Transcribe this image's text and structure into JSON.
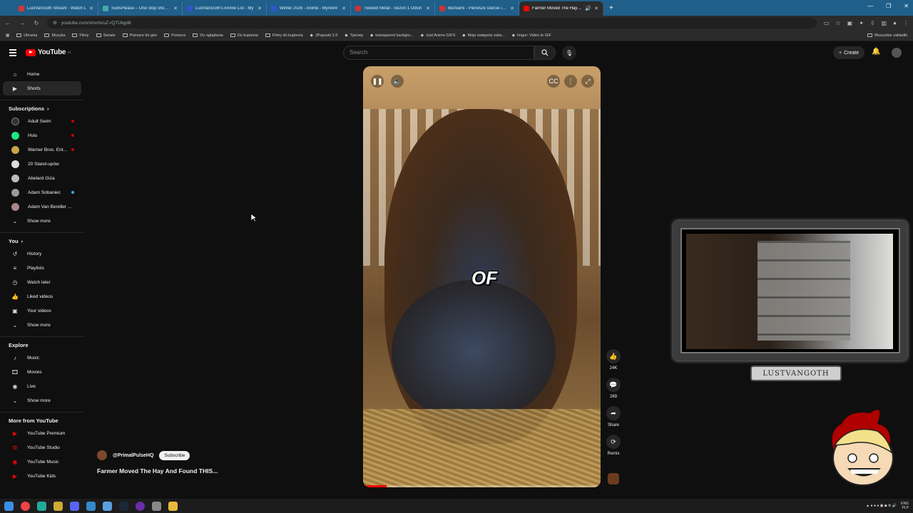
{
  "browser": {
    "tabs": [
      {
        "label": "LustVanGoth Stream · Watch L",
        "color": "#d33"
      },
      {
        "label": "SubsPlease – One stop shop fo",
        "color": "#4aa"
      },
      {
        "label": "LustVanGoth's Anime List - My",
        "color": "#35c"
      },
      {
        "label": "Winter 2026 - Anime - MyAnim",
        "color": "#35c"
      },
      {
        "label": "Twisted Metal - Sezon 1 Odcin",
        "color": "#c33"
      },
      {
        "label": "Bezkarni - Pierwsze starcie / Th",
        "color": "#c33"
      },
      {
        "label": "Farmer Moved The Hay An",
        "color": "#f00",
        "active": true
      }
    ],
    "url": "youtube.com/shorts/uZ-rQ7Ukgd8",
    "bookmarks": [
      "Ubrania",
      "Muzyka",
      "Filmy",
      "Seriale",
      "Pomoce do gier",
      "Pomoce",
      "Do oglądania",
      "Do kupienia",
      "Filmy do kupienia",
      "JPopsuki 2.0",
      "Tpexep",
      "transparent backgro...",
      "Just Anime GIFS",
      "Moje wstępnie zatw...",
      "Imgur: Video to GIF"
    ],
    "bookmarks_right": "Wszystkie zakładki"
  },
  "youtube": {
    "logo": "YouTube",
    "region": "PL",
    "search_placeholder": "Search",
    "create_label": "Create",
    "sidebar": {
      "top": [
        {
          "label": "Home",
          "icon": "home"
        },
        {
          "label": "Shorts",
          "icon": "shorts",
          "active": true
        }
      ],
      "subscriptions_title": "Subscriptions",
      "subscriptions": [
        {
          "label": "Adult Swim",
          "live": true,
          "color": "#333"
        },
        {
          "label": "Hulu",
          "live": true,
          "color": "#1ce783"
        },
        {
          "label": "Warner Bros. Ent...",
          "live": true,
          "color": "#c9a44a"
        },
        {
          "label": "20 Stand-upów",
          "live": false,
          "color": "#ddd"
        },
        {
          "label": "Abelard Giza",
          "live": false,
          "color": "#bbb"
        },
        {
          "label": "Adam Sobaniec",
          "live": true,
          "color": "#999",
          "dot": "#3ea6ff"
        },
        {
          "label": "Adam Van Bendler ...",
          "live": false,
          "color": "#a88"
        }
      ],
      "show_more": "Show more",
      "you_title": "You",
      "you": [
        {
          "label": "History",
          "icon": "history"
        },
        {
          "label": "Playlists",
          "icon": "playlists"
        },
        {
          "label": "Watch later",
          "icon": "watch-later"
        },
        {
          "label": "Liked videos",
          "icon": "liked"
        },
        {
          "label": "Your videos",
          "icon": "your-videos"
        },
        {
          "label": "Show more",
          "icon": "chevron"
        }
      ],
      "explore_title": "Explore",
      "explore": [
        {
          "label": "Music",
          "icon": "music"
        },
        {
          "label": "Movies",
          "icon": "movies"
        },
        {
          "label": "Live",
          "icon": "live"
        },
        {
          "label": "Show more",
          "icon": "chevron"
        }
      ],
      "more_title": "More from YouTube",
      "more": [
        {
          "label": "YouTube Premium"
        },
        {
          "label": "YouTube Studio"
        },
        {
          "label": "YouTube Music"
        },
        {
          "label": "YouTube Kids"
        }
      ]
    },
    "short": {
      "caption": "OF",
      "channel": "@PrimalPulseHQ",
      "subscribe_label": "Subscribe",
      "title": "Farmer Moved The Hay And Found THIS...",
      "progress": 0.1,
      "actions": [
        {
          "icon": "like",
          "label": "24K"
        },
        {
          "icon": "comment",
          "label": "269"
        },
        {
          "icon": "share",
          "label": "Share"
        },
        {
          "icon": "remix",
          "label": "Remix"
        }
      ]
    }
  },
  "overlay": {
    "banner": "LUSTVANGOTH"
  },
  "taskbar": {
    "lang": "ENG",
    "locale": "PLP"
  }
}
